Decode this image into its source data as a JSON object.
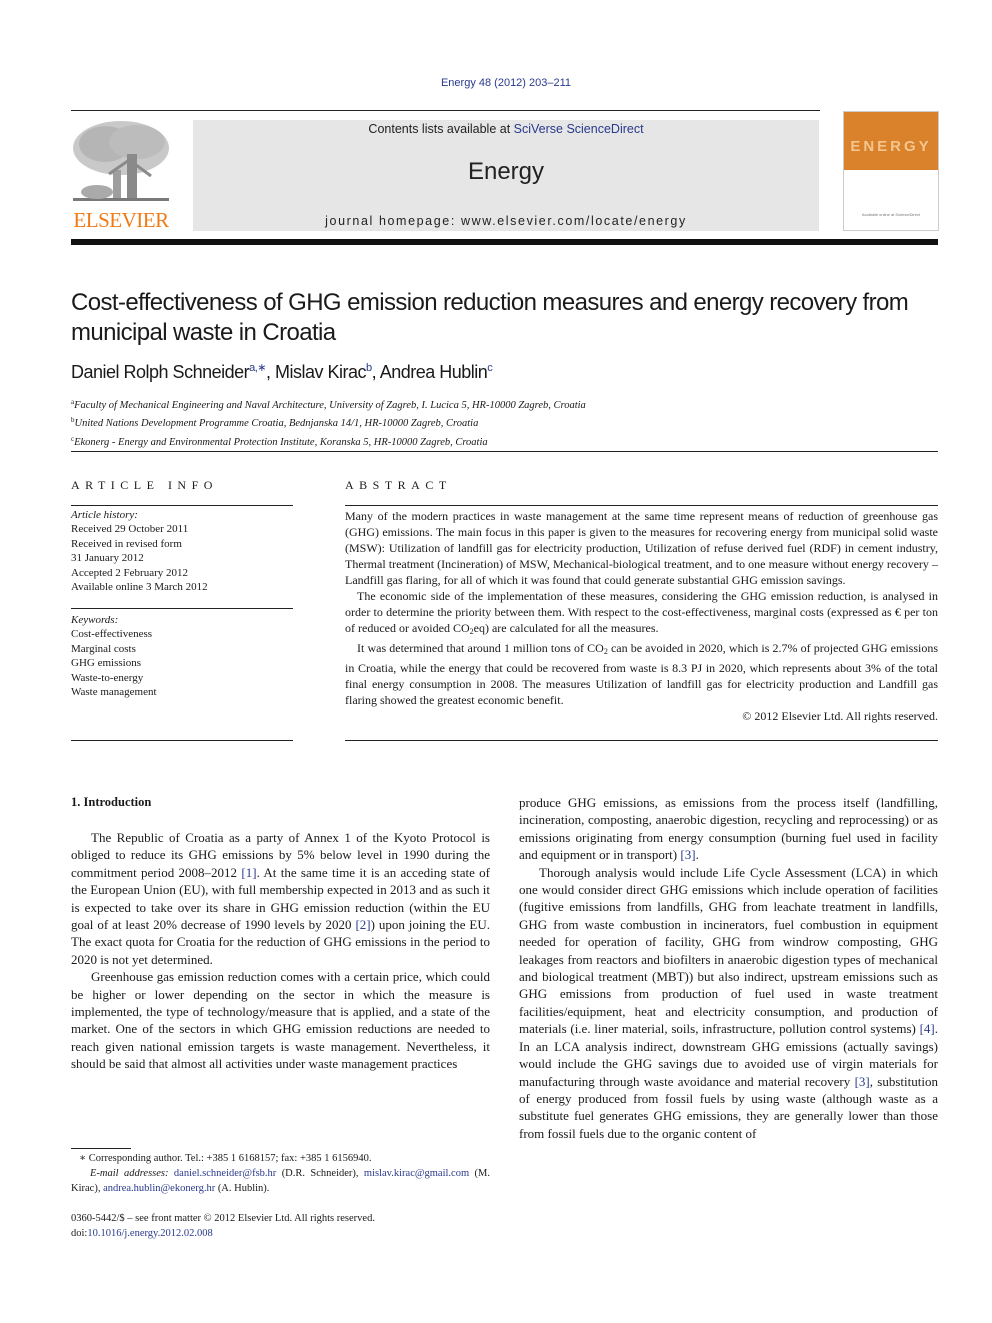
{
  "header": {
    "citation": "Energy 48 (2012) 203–211",
    "contents_prefix": "Contents lists available at ",
    "contents_link": "SciVerse ScienceDirect",
    "journal_name": "Energy",
    "homepage": "journal homepage: www.elsevier.com/locate/energy",
    "publisher_wordmark": "ELSEVIER",
    "cover_title": "ENERGY",
    "cover_caption": "Available online at ScienceDirect",
    "colors": {
      "link": "#2a3a8c",
      "elsevier_orange": "#f07b16",
      "cover_orange": "#d9822b",
      "banner_gray": "#e6e6e6"
    }
  },
  "article": {
    "title": "Cost-effectiveness of GHG emission reduction measures and energy recovery from municipal waste in Croatia",
    "authors": [
      {
        "name": "Daniel Rolph Schneider",
        "sup": "a,∗",
        "sep": ", "
      },
      {
        "name": "Mislav Kirac",
        "sup": "b",
        "sep": ", "
      },
      {
        "name": "Andrea Hublin",
        "sup": "c",
        "sep": ""
      }
    ],
    "affiliations": [
      {
        "key": "a",
        "text": "Faculty of Mechanical Engineering and Naval Architecture, University of Zagreb, I. Lucica 5, HR-10000 Zagreb, Croatia"
      },
      {
        "key": "b",
        "text": "United Nations Development Programme Croatia, Bednjanska 14/1, HR-10000 Zagreb, Croatia"
      },
      {
        "key": "c",
        "text": "Ekonerg - Energy and Environmental Protection Institute, Koranska 5, HR-10000 Zagreb, Croatia"
      }
    ]
  },
  "article_info": {
    "heading": "ARTICLE INFO",
    "history_label": "Article history:",
    "history": [
      "Received 29 October 2011",
      "Received in revised form",
      "31 January 2012",
      "Accepted 2 February 2012",
      "Available online 3 March 2012"
    ],
    "keywords_label": "Keywords:",
    "keywords": [
      "Cost-effectiveness",
      "Marginal costs",
      "GHG emissions",
      "Waste-to-energy",
      "Waste management"
    ]
  },
  "abstract": {
    "heading": "ABSTRACT",
    "p1": "Many of the modern practices in waste management at the same time represent means of reduction of greenhouse gas (GHG) emissions. The main focus in this paper is given to the measures for recovering energy from municipal solid waste (MSW): Utilization of landfill gas for electricity production, Utilization of refuse derived fuel (RDF) in cement industry, Thermal treatment (Incineration) of MSW, Mechanical-biological treatment, and to one measure without energy recovery – Landfill gas flaring, for all of which it was found that could generate substantial GHG emission savings.",
    "p2_a": "The economic side of the implementation of these measures, considering the GHG emission reduction, is analysed in order to determine the priority between them. With respect to the cost-effectiveness, marginal costs (expressed as € per ton of reduced or avoided CO",
    "p2_sub": "2",
    "p2_b": "eq) are calculated for all the measures.",
    "p3_a": "It was determined that around 1 million tons of CO",
    "p3_sub": "2",
    "p3_b": " can be avoided in 2020, which is 2.7% of projected GHG emissions in Croatia, while the energy that could be recovered from waste is 8.3 PJ in 2020, which represents about 3% of the total final energy consumption in 2008. The measures Utilization of landfill gas for electricity production and Landfill gas flaring showed the greatest economic benefit.",
    "copyright": "© 2012 Elsevier Ltd. All rights reserved."
  },
  "introduction": {
    "heading": "1.  Introduction",
    "left": {
      "p1_a": "The Republic of Croatia as a party of Annex 1 of the Kyoto Protocol is obliged to reduce its GHG emissions by 5% below level in 1990 during the commitment period 2008–2012 ",
      "p1_ref1": "[1]",
      "p1_b": ". At the same time it is an acceding state of the European Union (EU), with full membership expected in 2013 and as such it is expected to take over its share in GHG emission reduction (within the EU goal of at least 20% decrease of 1990 levels by 2020 ",
      "p1_ref2": "[2]",
      "p1_c": ") upon joining the EU. The exact quota for Croatia for the reduction of GHG emissions in the period to 2020 is not yet determined.",
      "p2": "Greenhouse gas emission reduction comes with a certain price, which could be higher or lower depending on the sector in which the measure is implemented, the type of technology/measure that is applied, and a state of the market. One of the sectors in which GHG emission reductions are needed to reach given national emission targets is waste management. Nevertheless, it should be said that almost all activities under waste management practices"
    },
    "right": {
      "p1_a": "produce GHG emissions, as emissions from the process itself (landfilling, incineration, composting, anaerobic digestion, recycling and reprocessing) or as emissions originating from energy consumption (burning fuel used in facility and equipment or in transport) ",
      "p1_ref": "[3]",
      "p1_b": ".",
      "p2_a": "Thorough analysis would include Life Cycle Assessment (LCA) in which one would consider direct GHG emissions which include operation of facilities (fugitive emissions from landfills, GHG from leachate treatment in landfills, GHG from waste combustion in incinerators, fuel combustion in equipment needed for operation of facility, GHG from windrow composting, GHG leakages from reactors and biofilters in anaerobic digestion types of mechanical and biological treatment (MBT)) but also indirect, upstream emissions such as GHG emissions from production of fuel used in waste treatment facilities/equipment, heat and electricity consumption, and production of materials (i.e. liner material, soils, infrastructure, pollution control systems) ",
      "p2_ref1": "[4]",
      "p2_b": ". In an LCA analysis indirect, downstream GHG emissions (actually savings) would include the GHG savings due to avoided use of virgin materials for manufacturing through waste avoidance and material recovery ",
      "p2_ref2": "[3]",
      "p2_c": ", substitution of energy produced from fossil fuels by using waste (although waste as a substitute fuel generates GHG emissions, they are generally lower than those from fossil fuels due to the organic content of"
    }
  },
  "footnotes": {
    "corresponding": "∗ Corresponding author. Tel.: +385 1 6168157; fax: +385 1 6156940.",
    "email_label": "E-mail addresses:",
    "email1": "daniel.schneider@fsb.hr",
    "email1_owner": " (D.R. Schneider), ",
    "email2": "mislav.kirac@gmail.com",
    "email2_owner": " (M. Kirac), ",
    "email3": "andrea.hublin@ekonerg.hr",
    "email3_owner": " (A. Hublin).",
    "front_matter": "0360-5442/$ – see front matter © 2012 Elsevier Ltd. All rights reserved.",
    "doi_label": "doi:",
    "doi": "10.1016/j.energy.2012.02.008"
  }
}
